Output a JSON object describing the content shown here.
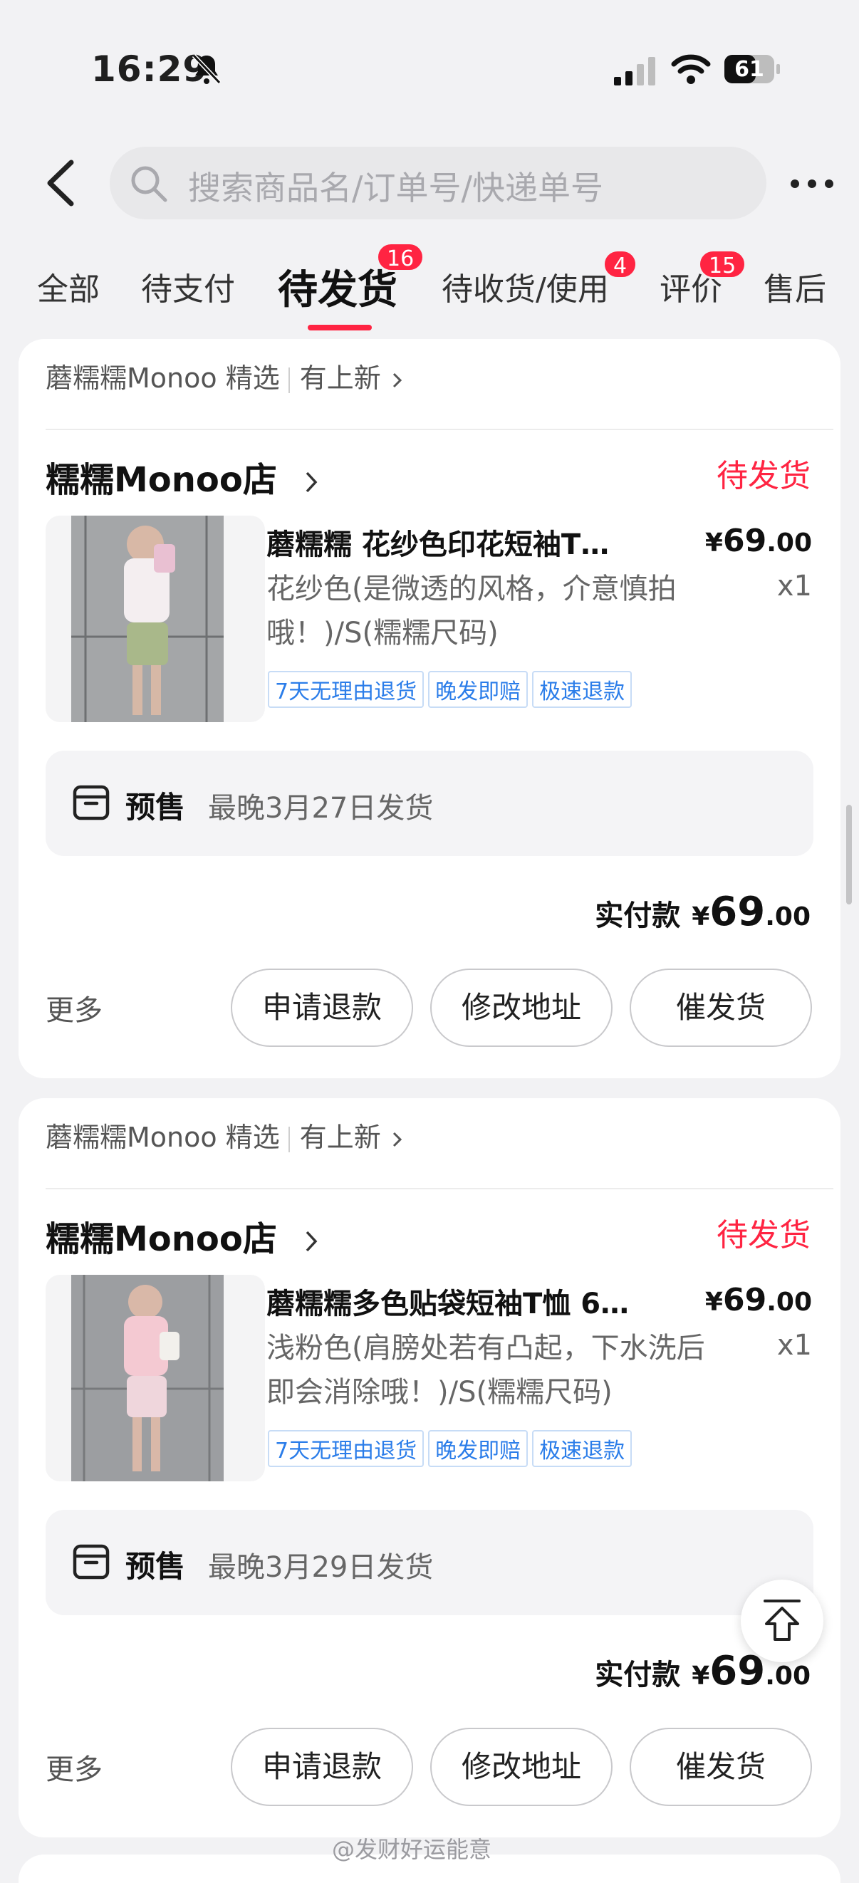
{
  "status_bar": {
    "time": "16:29",
    "battery": "61"
  },
  "search": {
    "placeholder": "搜索商品名/订单号/快递单号"
  },
  "tabs": [
    {
      "label": "全部"
    },
    {
      "label": "待支付"
    },
    {
      "label": "待发货",
      "badge": "16"
    },
    {
      "label": "待收货/使用",
      "badge": "4"
    },
    {
      "label": "评价",
      "badge": "15"
    },
    {
      "label": "售后"
    }
  ],
  "orders": [
    {
      "store_line": "蘑糯糯Monoo 精选",
      "new_label": "有上新",
      "shop": "糯糯Monoo店",
      "status": "待发货",
      "title": "蘑糯糯 花纱色印花短袖T…",
      "price_int": "69",
      "price_dec": ".00",
      "variant": "花纱色(是微透的风格，介意慎拍哦！)/S(糯糯尺码)",
      "qty": "x1",
      "tags": [
        "7天无理由退货",
        "晚发即赔",
        "极速退款"
      ],
      "presale_label": "预售",
      "presale_date": "最晚3月27日发货",
      "paid_label": "实付款",
      "total_int": "69",
      "total_dec": ".00",
      "more": "更多",
      "buttons": [
        "申请退款",
        "修改地址",
        "催发货"
      ]
    },
    {
      "store_line": "蘑糯糯Monoo 精选",
      "new_label": "有上新",
      "shop": "糯糯Monoo店",
      "status": "待发货",
      "title": "蘑糯糯多色贴袋短袖T恤 6…",
      "price_int": "69",
      "price_dec": ".00",
      "variant": "浅粉色(肩膀处若有凸起，下水洗后即会消除哦！)/S(糯糯尺码)",
      "qty": "x1",
      "tags": [
        "7天无理由退货",
        "晚发即赔",
        "极速退款"
      ],
      "presale_label": "预售",
      "presale_date": "最晚3月29日发货",
      "paid_label": "实付款",
      "total_int": "69",
      "total_dec": ".00",
      "more": "更多",
      "buttons": [
        "申请退款",
        "修改地址",
        "催发货"
      ]
    }
  ],
  "currency": "¥",
  "watermark": "@发财好运能意",
  "colors": {
    "accent": "#ff2442",
    "tag_blue": "#2b7de9",
    "background": "#f2f2f4"
  }
}
